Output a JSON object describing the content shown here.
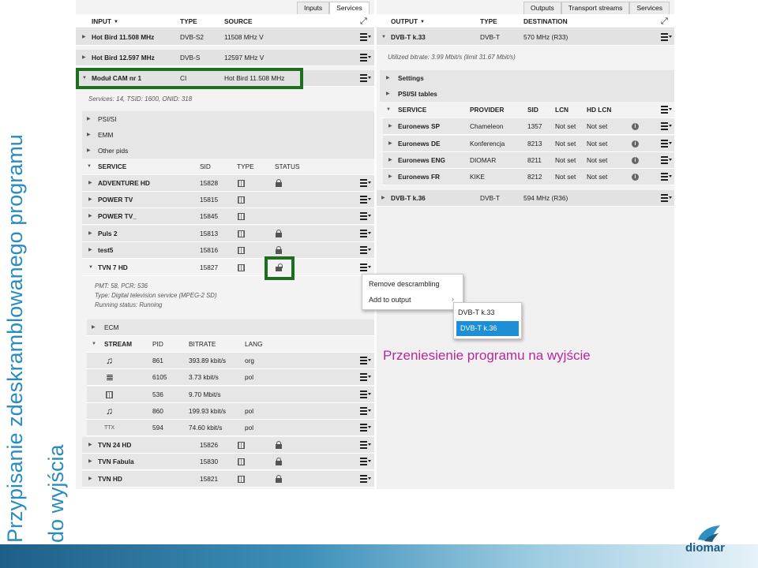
{
  "title_line1": "Przypisanie zdeskramblowanego programu",
  "title_line2": "do wyjścia",
  "left": {
    "tabs": [
      "Inputs",
      "Services"
    ],
    "header": {
      "input": "INPUT",
      "type": "TYPE",
      "source": "SOURCE"
    },
    "inputs": [
      {
        "name": "Hot Bird 11.508 MHz",
        "type": "DVB-S2",
        "source": "11508 MHz V"
      },
      {
        "name": "Hot Bird 12.597 MHz",
        "type": "DVB-S",
        "source": "12597 MHz V"
      },
      {
        "name": "Moduł CAM nr 1",
        "type": "CI",
        "source": "Hot Bird 11.508 MHz"
      }
    ],
    "info": "Services: 14, TSID: 1600, ONID: 318",
    "sections": [
      "PSI/SI",
      "EMM",
      "Other pids"
    ],
    "service_header": {
      "service": "SERVICE",
      "sid": "SID",
      "type": "TYPE",
      "status": "STATUS"
    },
    "services_a": [
      {
        "name": "ADVENTURE HD",
        "sid": "15828",
        "locked": true
      },
      {
        "name": "POWER TV",
        "sid": "15815",
        "locked": false
      },
      {
        "name": "POWER TV_",
        "sid": "15845",
        "locked": false
      },
      {
        "name": "Puls 2",
        "sid": "15813",
        "locked": true
      },
      {
        "name": "test5",
        "sid": "15816",
        "locked": true
      },
      {
        "name": "TVN 7 HD",
        "sid": "15827",
        "locked": false
      }
    ],
    "detail": {
      "pmt": "PMT: 58, PCR: 536",
      "type": "Type: Digital television service (MPEG-2 SD)",
      "status": "Running status: Running"
    },
    "ecm": "ECM",
    "stream_header": {
      "stream": "STREAM",
      "pid": "PID",
      "bitrate": "BITRATE",
      "lang": "LANG"
    },
    "streams": [
      {
        "icon": "audio-icon",
        "pid": "861",
        "bitrate": "393.89 kbit/s",
        "lang": "org"
      },
      {
        "icon": "subtitles-icon",
        "pid": "6105",
        "bitrate": "3.73 kbit/s",
        "lang": "pol"
      },
      {
        "icon": "video-icon",
        "pid": "536",
        "bitrate": "9.70 Mbit/s",
        "lang": ""
      },
      {
        "icon": "audio-icon",
        "pid": "860",
        "bitrate": "199.93 kbit/s",
        "lang": "pol"
      },
      {
        "icon": "TTX",
        "pid": "594",
        "bitrate": "74.60 kbit/s",
        "lang": "pol"
      }
    ],
    "services_b": [
      {
        "name": "TVN 24 HD",
        "sid": "15826"
      },
      {
        "name": "TVN Fabula",
        "sid": "15830"
      },
      {
        "name": "TVN HD",
        "sid": "15821"
      }
    ]
  },
  "right": {
    "tabs": [
      "Outputs",
      "Transport streams",
      "Services"
    ],
    "header": {
      "output": "OUTPUT",
      "type": "TYPE",
      "destination": "DESTINATION"
    },
    "out1": {
      "name": "DVB-T k.33",
      "type": "DVB-T",
      "dest": "570 MHz (R33)"
    },
    "bitrate": "Utilized bitrate: 3.99 Mbit/s (limit 31.67 Mbit/s)",
    "sections": [
      "Settings",
      "PSI/SI tables"
    ],
    "svc_header": {
      "service": "SERVICE",
      "provider": "PROVIDER",
      "sid": "SID",
      "lcn": "LCN",
      "hdlcn": "HD LCN"
    },
    "services": [
      {
        "name": "Euronews SP",
        "provider": "Chameleon",
        "sid": "1357",
        "lcn": "Not set",
        "hdlcn": "Not set"
      },
      {
        "name": "Euronews DE",
        "provider": "Konferencja",
        "sid": "8213",
        "lcn": "Not set",
        "hdlcn": "Not set"
      },
      {
        "name": "Euronews ENG",
        "provider": "DIOMAR",
        "sid": "8211",
        "lcn": "Not set",
        "hdlcn": "Not set"
      },
      {
        "name": "Euronews FR",
        "provider": "KIKE",
        "sid": "8212",
        "lcn": "Not set",
        "hdlcn": "Not set"
      }
    ],
    "out2": {
      "name": "DVB-T k.36",
      "type": "DVB-T",
      "dest": "594 MHz (R36)"
    }
  },
  "context_menu": [
    "Remove descrambling",
    "Add to output"
  ],
  "submenu": [
    "DVB-T k.33",
    "DVB-T k.36"
  ],
  "note": "Przeniesienie programu na wyjście",
  "logo": "diomar"
}
